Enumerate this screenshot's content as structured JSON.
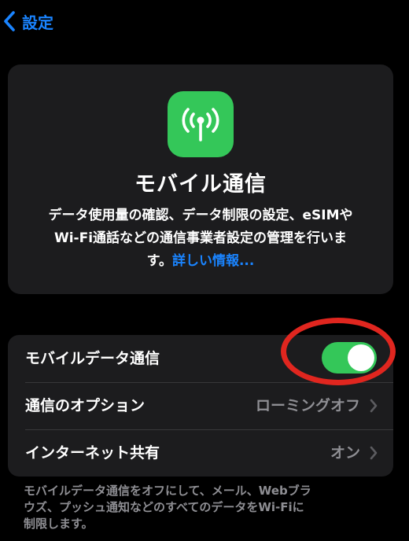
{
  "nav": {
    "back_label": "設定"
  },
  "hero": {
    "title": "モバイル通信",
    "description_lines": [
      "データ使用量の確認、データ制限の設定、eSIMや",
      "Wi-Fi通話などの通信事業者設定の管理を行いま",
      "す。"
    ],
    "link": "詳しい情報...",
    "icon": "antenna-radiowaves-icon"
  },
  "settings": {
    "rows": [
      {
        "label": "モバイルデータ通信",
        "control": "toggle",
        "toggle_on": true
      },
      {
        "label": "通信のオプション",
        "value": "ローミングオフ",
        "icon": "chevron-right-icon"
      },
      {
        "label": "インターネット共有",
        "value": "オン",
        "icon": "chevron-right-icon"
      }
    ]
  },
  "footer": {
    "lines": [
      "モバイルデータ通信をオフにして、メール、Webブラ",
      "ウズ、プッシュ通知などのすべてのデータをWi-Fiに",
      "制限します。"
    ]
  },
  "colors": {
    "background": "#000000",
    "card": "#1c1c1e",
    "accent_blue": "#1a84ff",
    "toggle_green": "#34c759",
    "secondary_text": "#8e8e93",
    "annotation_red": "#e0261f"
  }
}
